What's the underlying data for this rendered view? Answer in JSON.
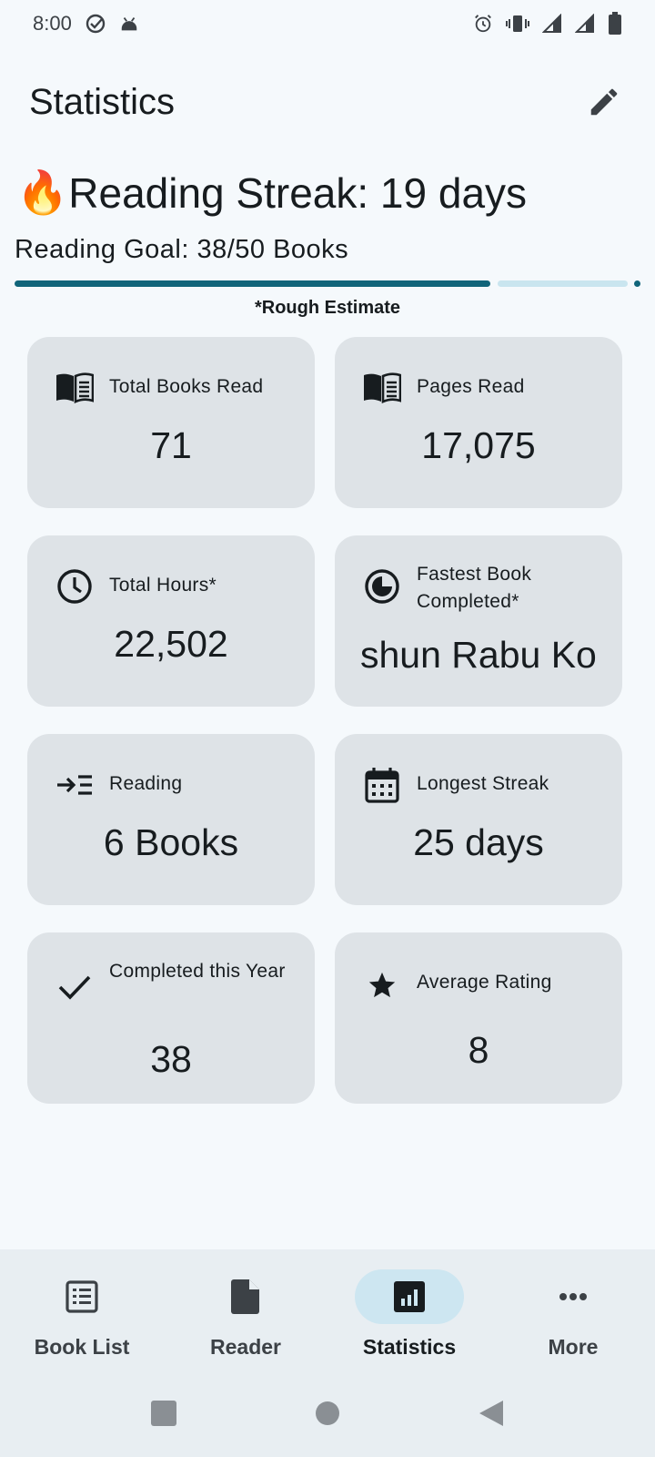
{
  "status_bar": {
    "time": "8:00",
    "icons_left": [
      "check-circle-icon",
      "android-debug-icon"
    ],
    "icons_right": [
      "alarm-icon",
      "vibrate-icon",
      "signal-icon",
      "signal-icon",
      "battery-icon"
    ]
  },
  "header": {
    "title": "Statistics",
    "edit_icon": "pencil-icon"
  },
  "streak": {
    "emoji": "🔥",
    "text": "Reading Streak: 19 days"
  },
  "goal": {
    "text": "Reading Goal: 38/50 Books",
    "progress": 0.76
  },
  "estimate_note": "*Rough Estimate",
  "cards": [
    {
      "label": "Total Books Read",
      "value": "71",
      "icon": "book-open-icon"
    },
    {
      "label": "Pages Read",
      "value": "17,075",
      "icon": "book-open-icon"
    },
    {
      "label": "Total Hours*",
      "value": "22,502",
      "icon": "clock-icon"
    },
    {
      "label": "Fastest Book Completed*",
      "value": "shun Rabu Ko",
      "icon": "timer-icon"
    },
    {
      "label": "Reading",
      "value": "6 Books",
      "icon": "arrow-list-icon"
    },
    {
      "label": "Longest Streak",
      "value": "25 days",
      "icon": "calendar-icon"
    },
    {
      "label": "Completed this Year",
      "value": "38",
      "icon": "check-icon"
    },
    {
      "label": "Average Rating",
      "value": "8",
      "icon": "star-icon"
    }
  ],
  "bottom_nav": [
    {
      "label": "Book List",
      "icon": "list-box-icon",
      "active": false
    },
    {
      "label": "Reader",
      "icon": "document-icon",
      "active": false
    },
    {
      "label": "Statistics",
      "icon": "bar-chart-icon",
      "active": true
    },
    {
      "label": "More",
      "icon": "more-horiz-icon",
      "active": false
    }
  ],
  "colors": {
    "accent": "#11657a",
    "card": "#dee3e7",
    "background": "#f5f9fc",
    "nav_active": "#cde6f1"
  }
}
